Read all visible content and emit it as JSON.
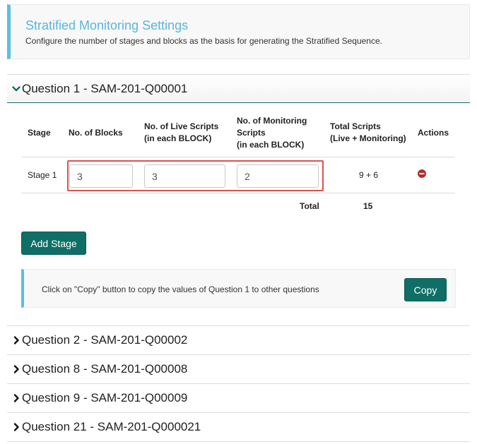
{
  "header": {
    "title": "Stratified Monitoring Settings",
    "description": "Configure the number of stages and blocks as the basis for generating the Stratified Sequence."
  },
  "questions": [
    {
      "label": "Question 1 - SAM-201-Q00001",
      "expanded": true
    },
    {
      "label": "Question 2 - SAM-201-Q00002",
      "expanded": false
    },
    {
      "label": "Question 8 - SAM-201-Q00008",
      "expanded": false
    },
    {
      "label": "Question 9 - SAM-201-Q00009",
      "expanded": false
    },
    {
      "label": "Question 21 - SAM-201-Q000021",
      "expanded": false
    }
  ],
  "table": {
    "headers": {
      "stage": "Stage",
      "blocks": "No. of Blocks",
      "live_1": "No. of Live Scripts",
      "live_2": "(in each BLOCK)",
      "mon_1": "No. of Monitoring",
      "mon_2": "Scripts",
      "mon_3": "(in each BLOCK)",
      "total_1": "Total Scripts",
      "total_2": "(Live + Monitoring)",
      "actions": "Actions"
    },
    "rows": [
      {
        "stage": "Stage 1",
        "blocks": "3",
        "live": "3",
        "monitoring": "2",
        "total": "9 + 6"
      }
    ],
    "total_label": "Total",
    "total_value": "15"
  },
  "buttons": {
    "add_stage": "Add Stage",
    "copy": "Copy"
  },
  "copy_info": "Click on \"Copy\" button to copy the values of Question 1 to other questions",
  "colors": {
    "accent": "#0f6f66",
    "info_border": "#5bc0de",
    "title": "#5bb5dc",
    "highlight": "#d9534f",
    "remove": "#b0302c"
  }
}
